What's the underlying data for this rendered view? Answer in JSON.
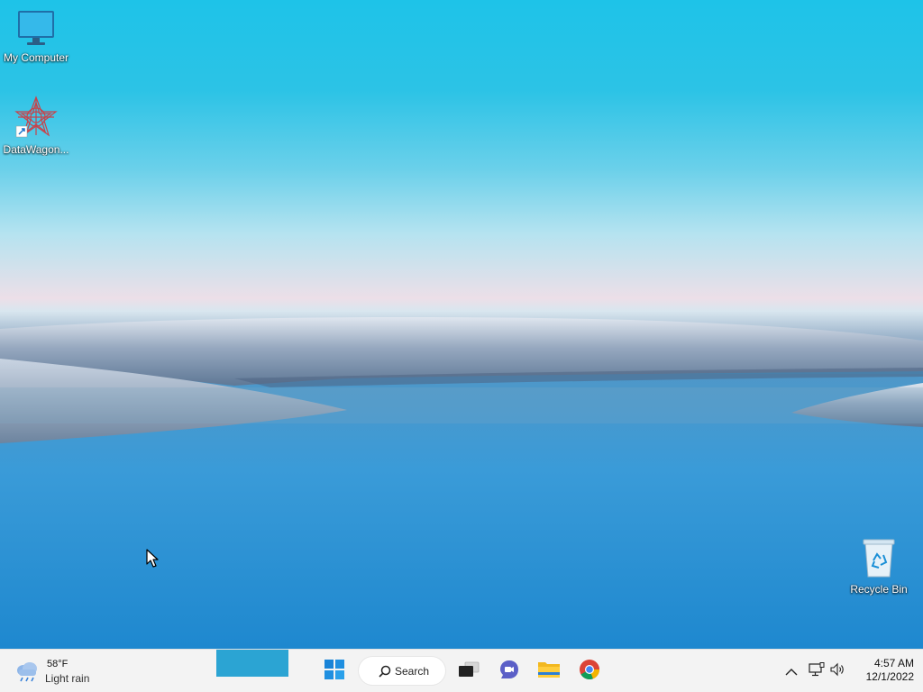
{
  "desktop": {
    "icons": [
      {
        "label": "My Computer",
        "icon": "monitor-icon"
      },
      {
        "label": "DataWagon...",
        "icon": "datawagon-app-icon"
      },
      {
        "label": "Recycle Bin",
        "icon": "recycle-bin-icon"
      }
    ]
  },
  "taskbar": {
    "weather": {
      "temp": "58°F",
      "condition": "Light rain",
      "icon": "rain-cloud-icon"
    },
    "search_label": "Search",
    "pinned": [
      {
        "name": "start",
        "icon": "windows-start-icon"
      },
      {
        "name": "task-view",
        "icon": "task-view-icon"
      },
      {
        "name": "chat",
        "icon": "teams-chat-icon"
      },
      {
        "name": "file-explorer",
        "icon": "folder-icon"
      },
      {
        "name": "chrome",
        "icon": "chrome-icon"
      }
    ],
    "tray": {
      "icons": [
        "chevron-up-icon",
        "network-icon",
        "volume-icon"
      ],
      "time": "4:57 AM",
      "date": "12/1/2022"
    }
  },
  "colors": {
    "taskbar_bg": "#f3f3f3",
    "accent": "#0078d4",
    "sky_top": "#1ec3e8",
    "water": "#2a93d4"
  }
}
